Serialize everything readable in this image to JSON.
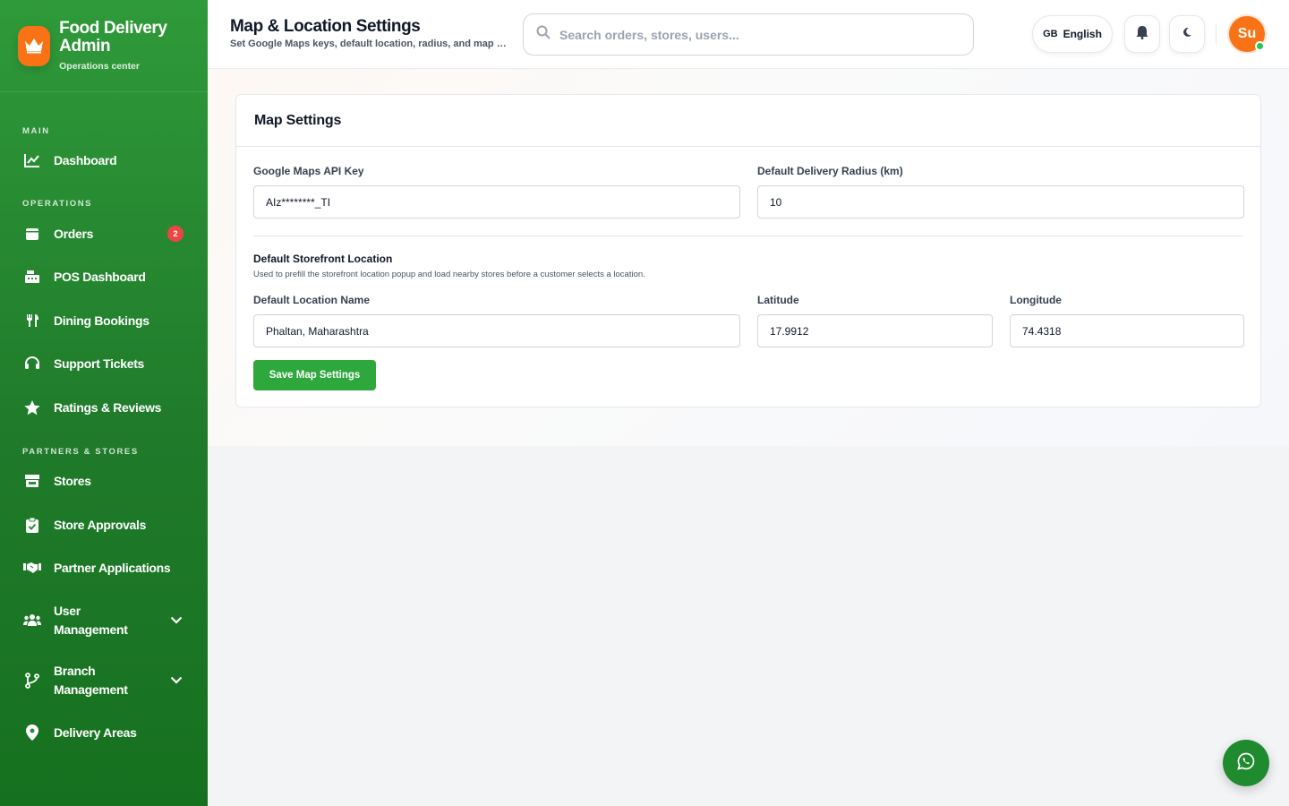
{
  "brand": {
    "title": "Food Delivery Admin",
    "subtitle": "Operations center",
    "logo_icon": "crown-icon"
  },
  "sidebar": {
    "sections": [
      "MAIN",
      "OPERATIONS",
      "PARTNERS & STORES"
    ],
    "items": [
      {
        "label": "Dashboard",
        "icon": "chart-line-icon"
      },
      {
        "label": "Orders",
        "icon": "calendar-icon",
        "badge": "2"
      },
      {
        "label": "POS Dashboard",
        "icon": "cash-register-icon"
      },
      {
        "label": "Dining Bookings",
        "icon": "utensils-icon"
      },
      {
        "label": "Support Tickets",
        "icon": "headset-icon"
      },
      {
        "label": "Ratings & Reviews",
        "icon": "star-icon"
      },
      {
        "label": "Stores",
        "icon": "store-icon"
      },
      {
        "label": "Store Approvals",
        "icon": "clipboard-check-icon"
      },
      {
        "label": "Partner Applications",
        "icon": "handshake-icon"
      },
      {
        "label": "User Management",
        "icon": "users-icon",
        "expandable": true
      },
      {
        "label": "Branch Management",
        "icon": "branch-icon",
        "expandable": true
      },
      {
        "label": "Delivery Areas",
        "icon": "map-pin-icon"
      }
    ]
  },
  "header": {
    "title": "Map & Location Settings",
    "subtitle": "Set Google Maps keys, default location, radius, and map preferences",
    "search_placeholder": "Search orders, stores, users...",
    "language_code": "GB",
    "language_label": "English",
    "avatar_initials": "Su"
  },
  "card": {
    "title": "Map Settings",
    "api_key_label": "Google Maps API Key",
    "api_key_value": "AIz********_TI",
    "radius_label": "Default Delivery Radius (km)",
    "radius_value": "10",
    "section_title": "Default Storefront Location",
    "section_desc": "Used to prefill the storefront location popup and load nearby stores before a customer selects a location.",
    "location_name_label": "Default Location Name",
    "location_name_value": "Phaltan, Maharashtra",
    "latitude_label": "Latitude",
    "latitude_value": "17.9912",
    "longitude_label": "Longitude",
    "longitude_value": "74.4318",
    "save_label": "Save Map Settings"
  },
  "colors": {
    "primary": "#2ea83d",
    "accent": "#f97316",
    "badge": "#ef4444"
  }
}
